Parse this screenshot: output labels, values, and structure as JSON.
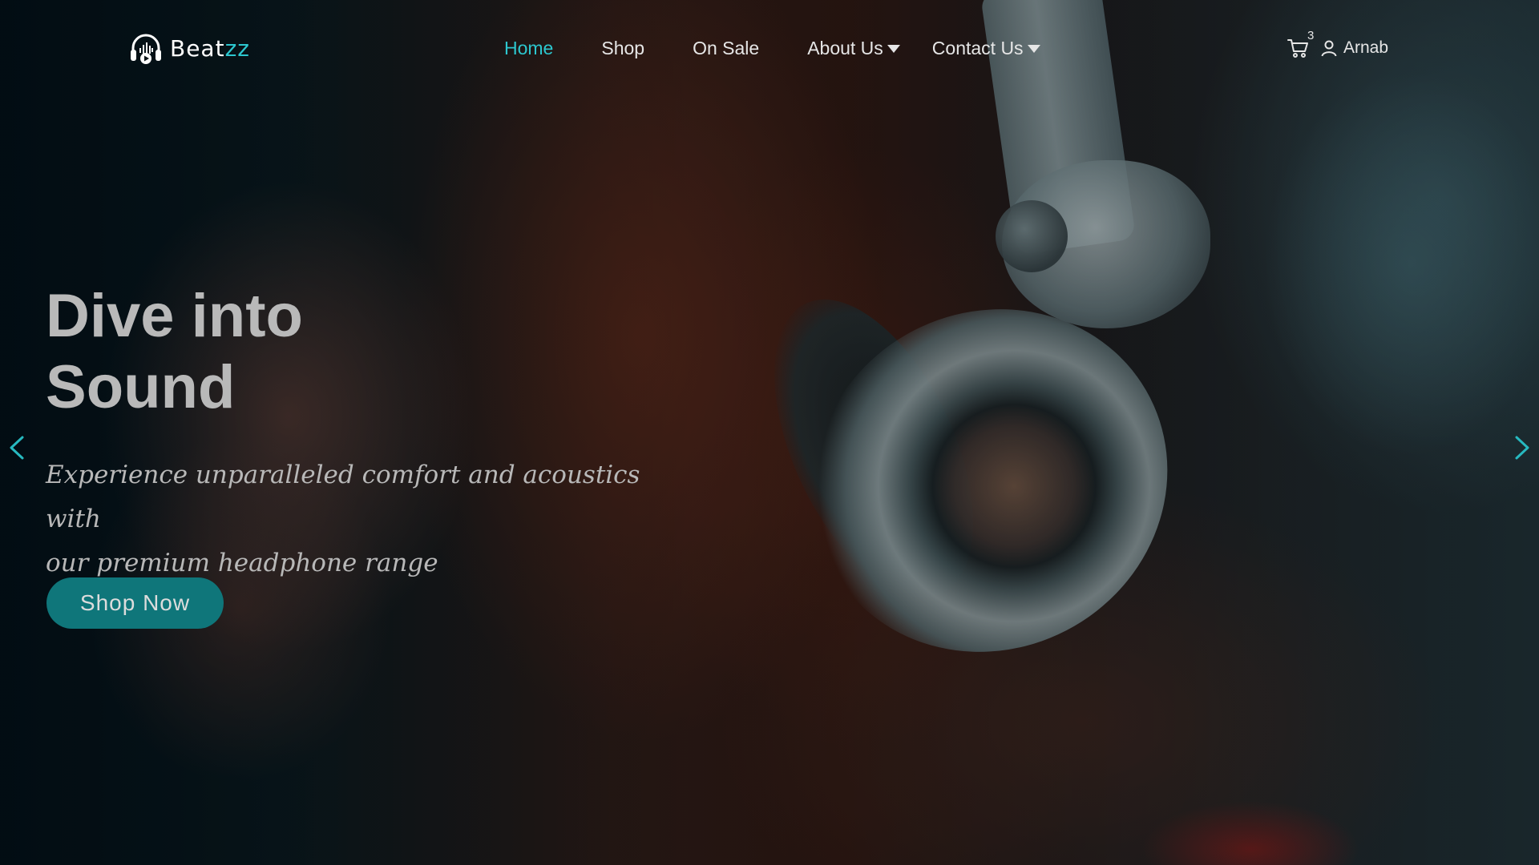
{
  "brand": {
    "name_main": "Beat",
    "name_accent": "zz",
    "accent_color": "#2cc7cf",
    "icon": "headphones-play-icon"
  },
  "nav": {
    "items": [
      {
        "label": "Home",
        "active": true
      },
      {
        "label": "Shop"
      },
      {
        "label": "On Sale"
      },
      {
        "label": "About Us",
        "dropdown": true
      },
      {
        "label": "Contact Us",
        "dropdown": true
      }
    ]
  },
  "toolbar": {
    "cart_icon": "cart-icon",
    "cart_count": "3",
    "user_icon": "user-icon",
    "user_name": "Arnab"
  },
  "hero": {
    "title_line1": "Dive into",
    "title_line2": "Sound",
    "subtitle_line1": "Experience unparalleled comfort and acoustics with",
    "subtitle_line2": "our premium headphone range",
    "cta_label": "Shop Now",
    "cta_color": "#0f767a",
    "prev_icon": "chevron-left-icon",
    "next_icon": "chevron-right-icon"
  }
}
